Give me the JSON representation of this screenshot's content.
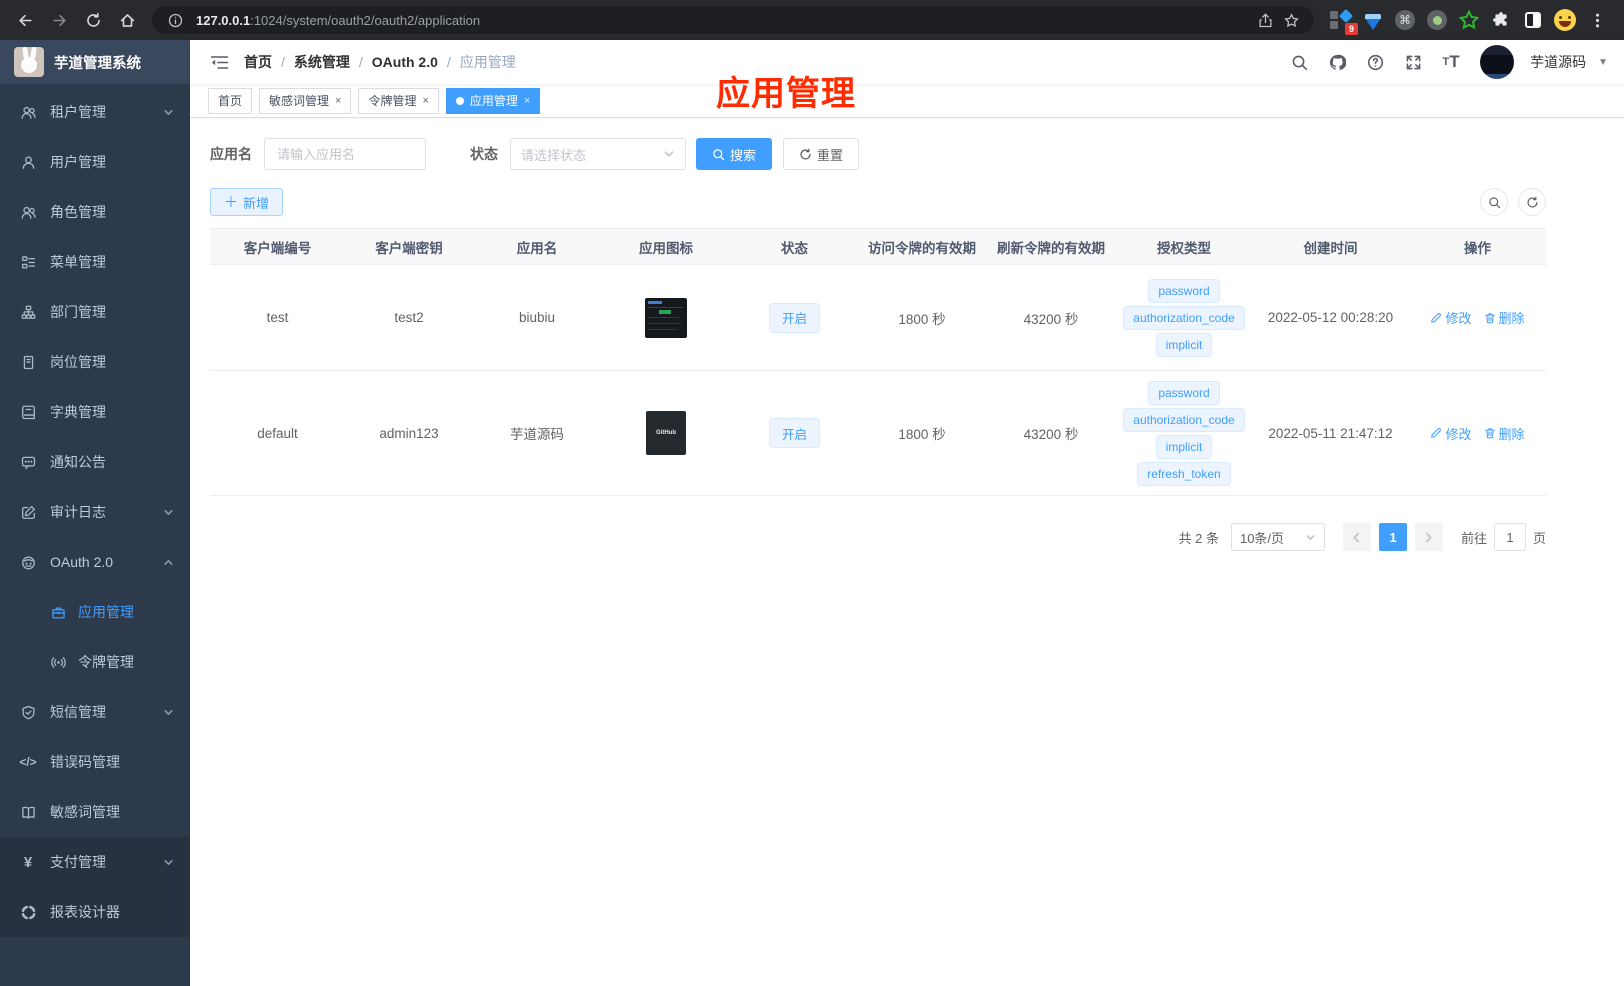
{
  "browser": {
    "url_host": "127.0.0.1",
    "url_rest": ":1024/system/oauth2/oauth2/application",
    "ext_badge": "9",
    "cmd_glyph": "⌘"
  },
  "annotation": {
    "text": "应用管理",
    "color": "#fe2c00"
  },
  "sidebar": {
    "title": "芋道管理系统",
    "items": [
      {
        "id": "tenant",
        "label": "租户管理",
        "icon": "users",
        "arrow": "down"
      },
      {
        "id": "user",
        "label": "用户管理",
        "icon": "user"
      },
      {
        "id": "role",
        "label": "角色管理",
        "icon": "users"
      },
      {
        "id": "menu",
        "label": "菜单管理",
        "icon": "menu"
      },
      {
        "id": "dept",
        "label": "部门管理",
        "icon": "dept"
      },
      {
        "id": "post",
        "label": "岗位管理",
        "icon": "post"
      },
      {
        "id": "dict",
        "label": "字典管理",
        "icon": "dict"
      },
      {
        "id": "notice",
        "label": "通知公告",
        "icon": "notice"
      },
      {
        "id": "audit",
        "label": "审计日志",
        "icon": "audit",
        "arrow": "down"
      },
      {
        "id": "oauth2",
        "label": "OAuth 2.0",
        "icon": "oauth",
        "arrow": "up"
      },
      {
        "id": "oauth2-app",
        "label": "应用管理",
        "icon": "app",
        "child": true,
        "active": true
      },
      {
        "id": "oauth2-token",
        "label": "令牌管理",
        "icon": "token",
        "child": true
      },
      {
        "id": "sms",
        "label": "短信管理",
        "icon": "sms",
        "arrow": "down"
      },
      {
        "id": "errcode",
        "label": "错误码管理",
        "icon": "errcode"
      },
      {
        "id": "sensitive",
        "label": "敏感词管理",
        "icon": "sensitive"
      },
      {
        "id": "pay",
        "label": "支付管理",
        "icon": "pay",
        "arrow": "down",
        "dark": true
      },
      {
        "id": "report",
        "label": "报表设计器",
        "icon": "report",
        "dark": true
      }
    ]
  },
  "header": {
    "breadcrumb": [
      "首页",
      "系统管理",
      "OAuth 2.0",
      "应用管理"
    ],
    "user_name": "芋道源码"
  },
  "tabs": [
    {
      "label": "首页",
      "closable": false,
      "active": false
    },
    {
      "label": "敏感词管理",
      "closable": true,
      "active": false
    },
    {
      "label": "令牌管理",
      "closable": true,
      "active": false
    },
    {
      "label": "应用管理",
      "closable": true,
      "active": true
    }
  ],
  "filter": {
    "name_label": "应用名",
    "name_placeholder": "请输入应用名",
    "status_label": "状态",
    "status_placeholder": "请选择状态",
    "search_label": "搜索",
    "reset_label": "重置"
  },
  "toolbar": {
    "add_label": "新增"
  },
  "table": {
    "headers": [
      "客户端编号",
      "客户端密钥",
      "应用名",
      "应用图标",
      "状态",
      "访问令牌的有效期",
      "刷新令牌的有效期",
      "授权类型",
      "创建时间",
      "操作"
    ],
    "actions": {
      "edit": "修改",
      "delete": "删除"
    },
    "rows": [
      {
        "client_id": "test",
        "secret": "test2",
        "name": "biubiu",
        "icon_type": "terminal-screenshot",
        "icon_label": "",
        "status": "开启",
        "access_ttl": "1800 秒",
        "refresh_ttl": "43200 秒",
        "grants": [
          "password",
          "authorization_code",
          "implicit"
        ],
        "created": "2022-05-12 00:28:20"
      },
      {
        "client_id": "default",
        "secret": "admin123",
        "name": "芋道源码",
        "icon_type": "github-logo",
        "icon_label": "GitHub",
        "status": "开启",
        "access_ttl": "1800 秒",
        "refresh_ttl": "43200 秒",
        "grants": [
          "password",
          "authorization_code",
          "implicit",
          "refresh_token"
        ],
        "created": "2022-05-11 21:47:12"
      }
    ]
  },
  "pagination": {
    "total": "共 2 条",
    "per_page": "10条/页",
    "page": "1",
    "goto_label": "前往",
    "goto_value": "1",
    "page_unit": "页"
  },
  "colors": {
    "accent": "#409eff",
    "tag_bg": "#ecf5ff",
    "tag_border": "#d9ecff",
    "sidebar_bg": "#2d3a4b"
  }
}
